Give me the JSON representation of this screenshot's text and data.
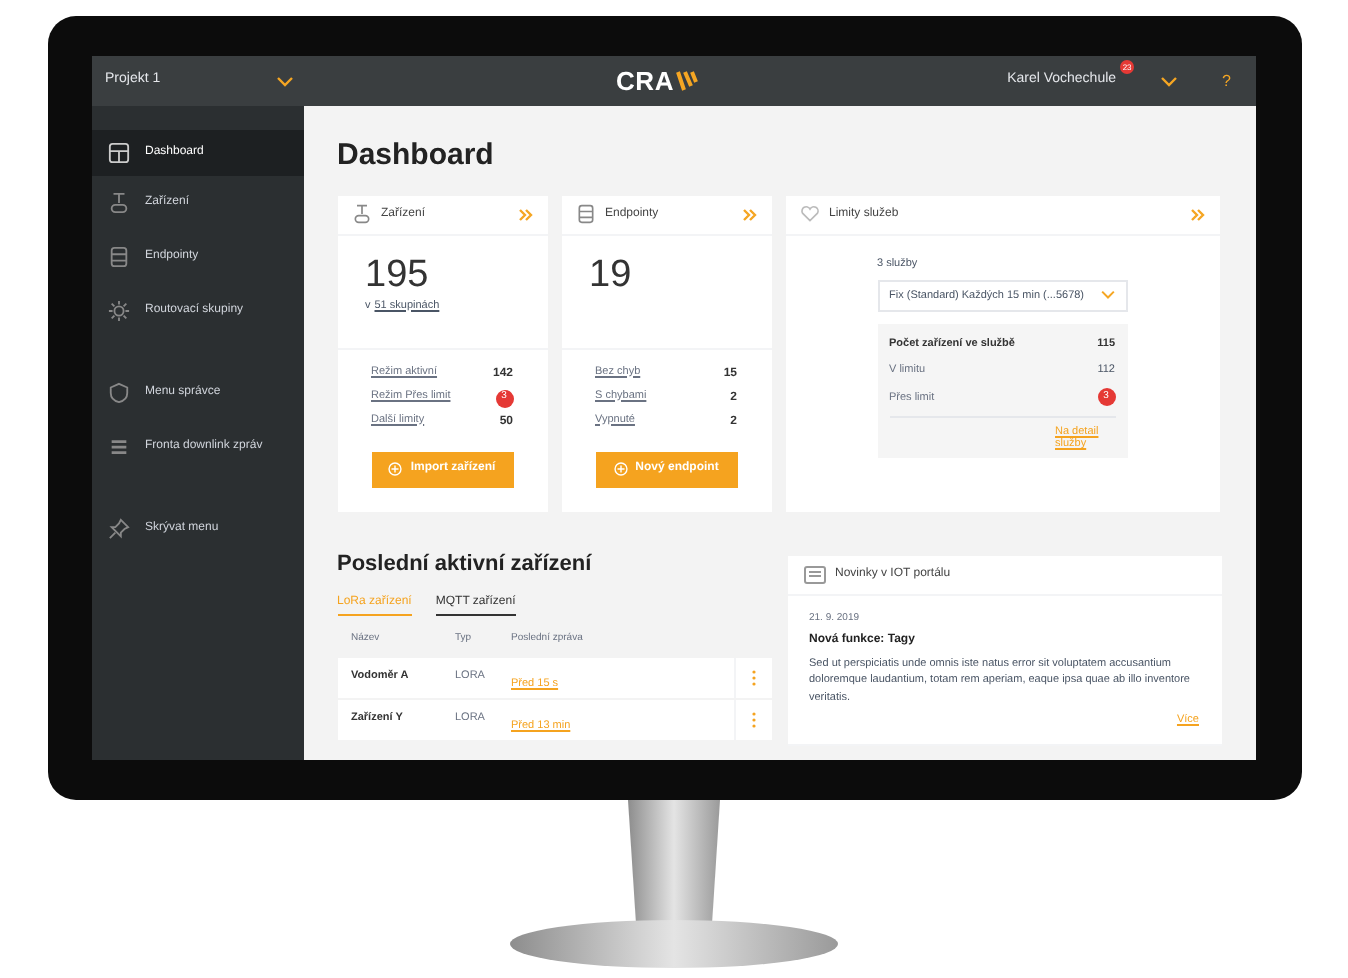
{
  "topbar": {
    "project": "Projekt 1",
    "logo": "CRA",
    "user": "Karel Vochechule",
    "notifications": "23",
    "help": "?"
  },
  "sidebar": {
    "items": [
      {
        "label": "Dashboard",
        "kind": "grid",
        "selected": true
      },
      {
        "label": "Zařízení",
        "kind": "device",
        "selected": false
      },
      {
        "label": "Endpointy",
        "kind": "server",
        "selected": false
      },
      {
        "label": "Routovací skupiny",
        "kind": "sun",
        "selected": false
      },
      {
        "label": "Menu správce",
        "kind": "shield",
        "selected": false
      },
      {
        "label": "Fronta downlink zpráv",
        "kind": "queue",
        "selected": false
      },
      {
        "label": "Skrývat menu",
        "kind": "pin",
        "selected": false
      }
    ]
  },
  "title": "Dashboard",
  "devices_card": {
    "title": "Zařízení",
    "count": "195",
    "groups_prefix": "v",
    "groups_link": "51 skupinách",
    "stats": [
      {
        "label": "Režim aktivní",
        "value": "142",
        "alert": false
      },
      {
        "label": "Režim Přes limit",
        "value": "3",
        "alert": true
      },
      {
        "label": "Další limity",
        "value": "50",
        "alert": false
      }
    ],
    "button": "Import zařízení"
  },
  "endpoints_card": {
    "title": "Endpointy",
    "count": "19",
    "stats": [
      {
        "label": "Bez chyb",
        "value": "15",
        "alert": false
      },
      {
        "label": "S chybami",
        "value": "2",
        "alert": false
      },
      {
        "label": "Vypnuté",
        "value": "2",
        "alert": false
      }
    ],
    "button": "Nový endpoint"
  },
  "limits_card": {
    "title": "Limity služeb",
    "services": "3 služby",
    "select": "Fix (Standard) Každých 15 min (...5678)",
    "rows": [
      {
        "label": "Počet zařízení ve službě",
        "value": "115",
        "alert": false,
        "bold": true
      },
      {
        "label": "V limitu",
        "value": "112",
        "alert": false,
        "bold": false
      },
      {
        "label": "Přes limit",
        "value": "3",
        "alert": true,
        "bold": false
      }
    ],
    "link": "Na detail služby"
  },
  "recent": {
    "title": "Poslední aktivní zařízení",
    "tabs": [
      {
        "label": "LoRa zařízení",
        "selected": true
      },
      {
        "label": "MQTT zařízení",
        "selected": false
      }
    ],
    "table": {
      "columns": [
        "Název",
        "Typ",
        "Poslední zpráva"
      ],
      "rows": [
        [
          "Vodoměr A",
          "LORA",
          "Před 15 s"
        ],
        [
          "Zařízení Y",
          "LORA",
          "Před 13 min"
        ]
      ]
    }
  },
  "news": {
    "title": "Novinky v IOT portálu",
    "items": [
      {
        "date": "21. 9. 2019",
        "headline": "Nová funkce: Tagy",
        "text": "Sed ut perspiciatis unde omnis iste natus error sit voluptatem accusantium doloremque laudantium, totam rem aperiam, eaque ipsa quae ab illo inventore veritatis.",
        "more": "Více"
      }
    ]
  }
}
